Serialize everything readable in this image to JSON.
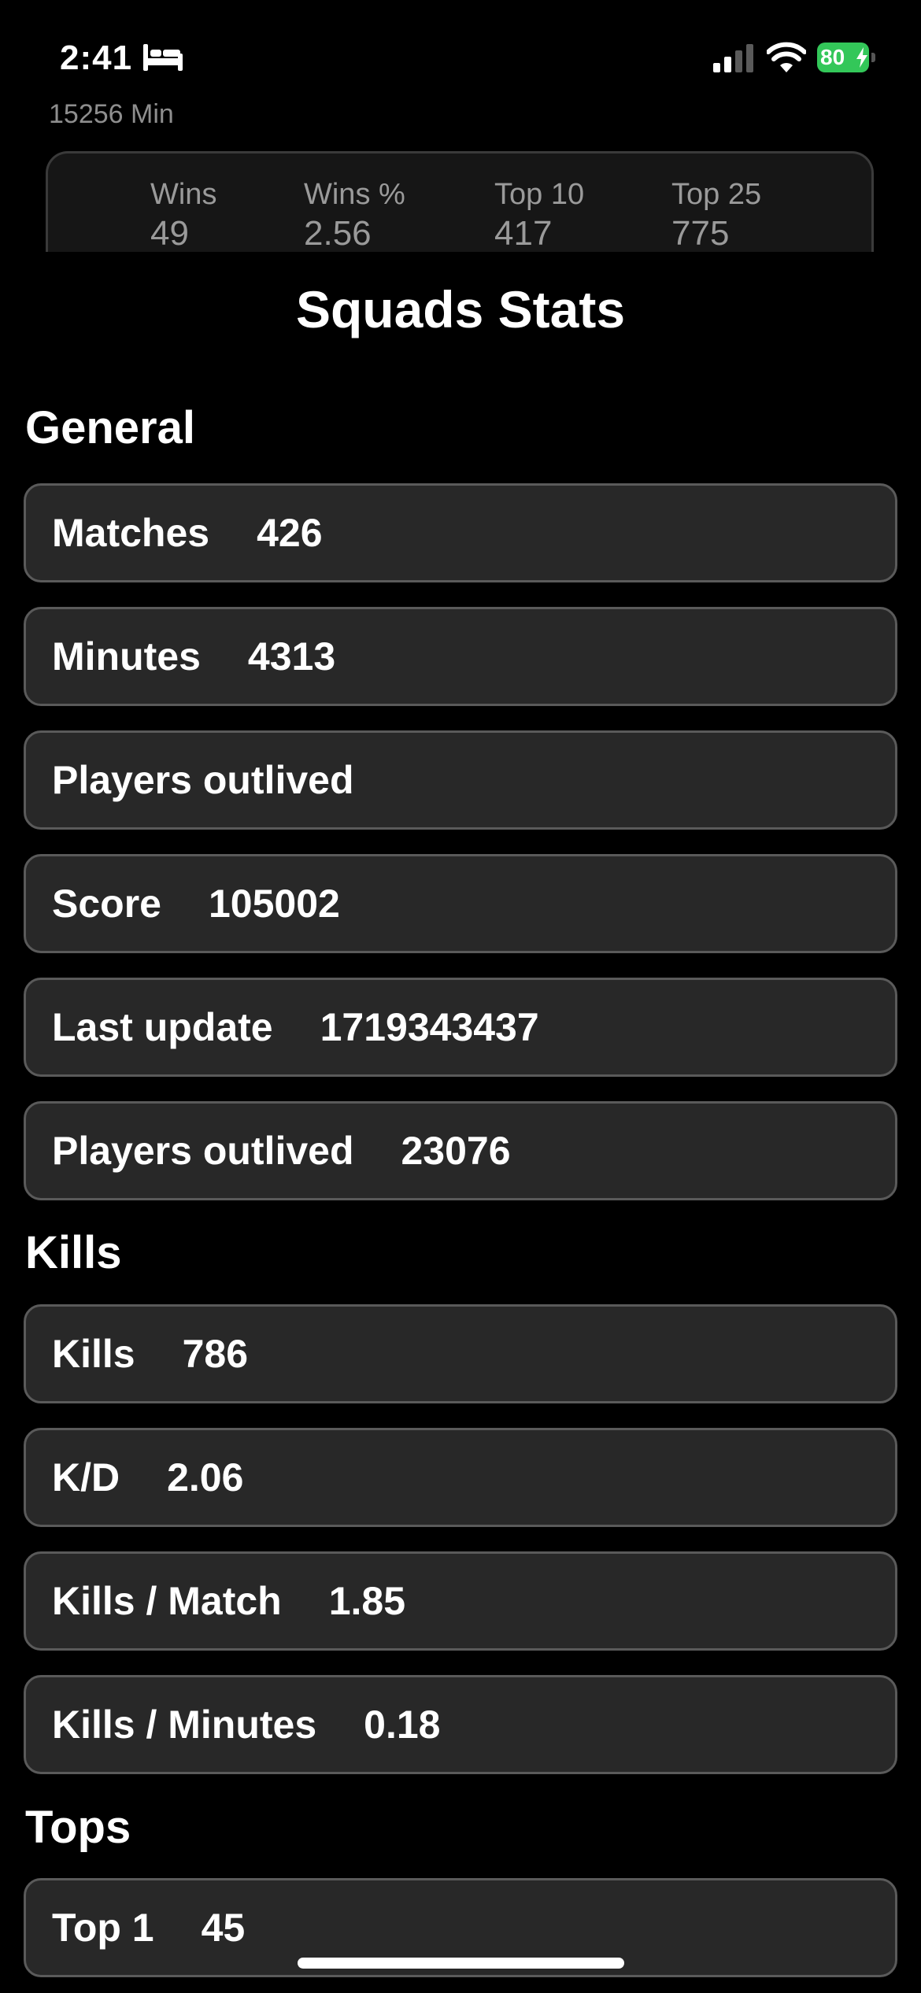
{
  "status_bar": {
    "time": "2:41",
    "battery_level": "80",
    "icons": [
      "bed-icon",
      "cellular-signal-icon",
      "wifi-icon",
      "battery-charging-icon"
    ],
    "battery_color": "#33c759"
  },
  "background_card": {
    "subtitle": "15256 Min",
    "stats": [
      {
        "label": "Wins",
        "value": "49"
      },
      {
        "label": "Wins %",
        "value": "2.56"
      },
      {
        "label": "Top 10",
        "value": "417"
      },
      {
        "label": "Top 25",
        "value": "775"
      }
    ]
  },
  "sheet": {
    "title": "Squads Stats",
    "sections": {
      "general": {
        "title": "General",
        "rows": [
          {
            "label": "Matches",
            "value": "426"
          },
          {
            "label": "Minutes",
            "value": "4313"
          },
          {
            "label": "Players outlived",
            "value": ""
          },
          {
            "label": "Score",
            "value": "105002"
          },
          {
            "label": "Last update",
            "value": "1719343437"
          },
          {
            "label": "Players outlived",
            "value": "23076"
          }
        ]
      },
      "kills": {
        "title": "Kills",
        "rows": [
          {
            "label": "Kills",
            "value": "786"
          },
          {
            "label": "K/D",
            "value": "2.06"
          },
          {
            "label": "Kills / Match",
            "value": "1.85"
          },
          {
            "label": "Kills / Minutes",
            "value": "0.18"
          }
        ]
      },
      "tops": {
        "title": "Tops",
        "rows": [
          {
            "label": "Top 1",
            "value": "45"
          }
        ]
      }
    }
  },
  "colors": {
    "background": "#000000",
    "row_background": "#282828",
    "row_border": "#5a5a5a",
    "text": "#ffffff",
    "muted_text": "#9a9a9a"
  }
}
